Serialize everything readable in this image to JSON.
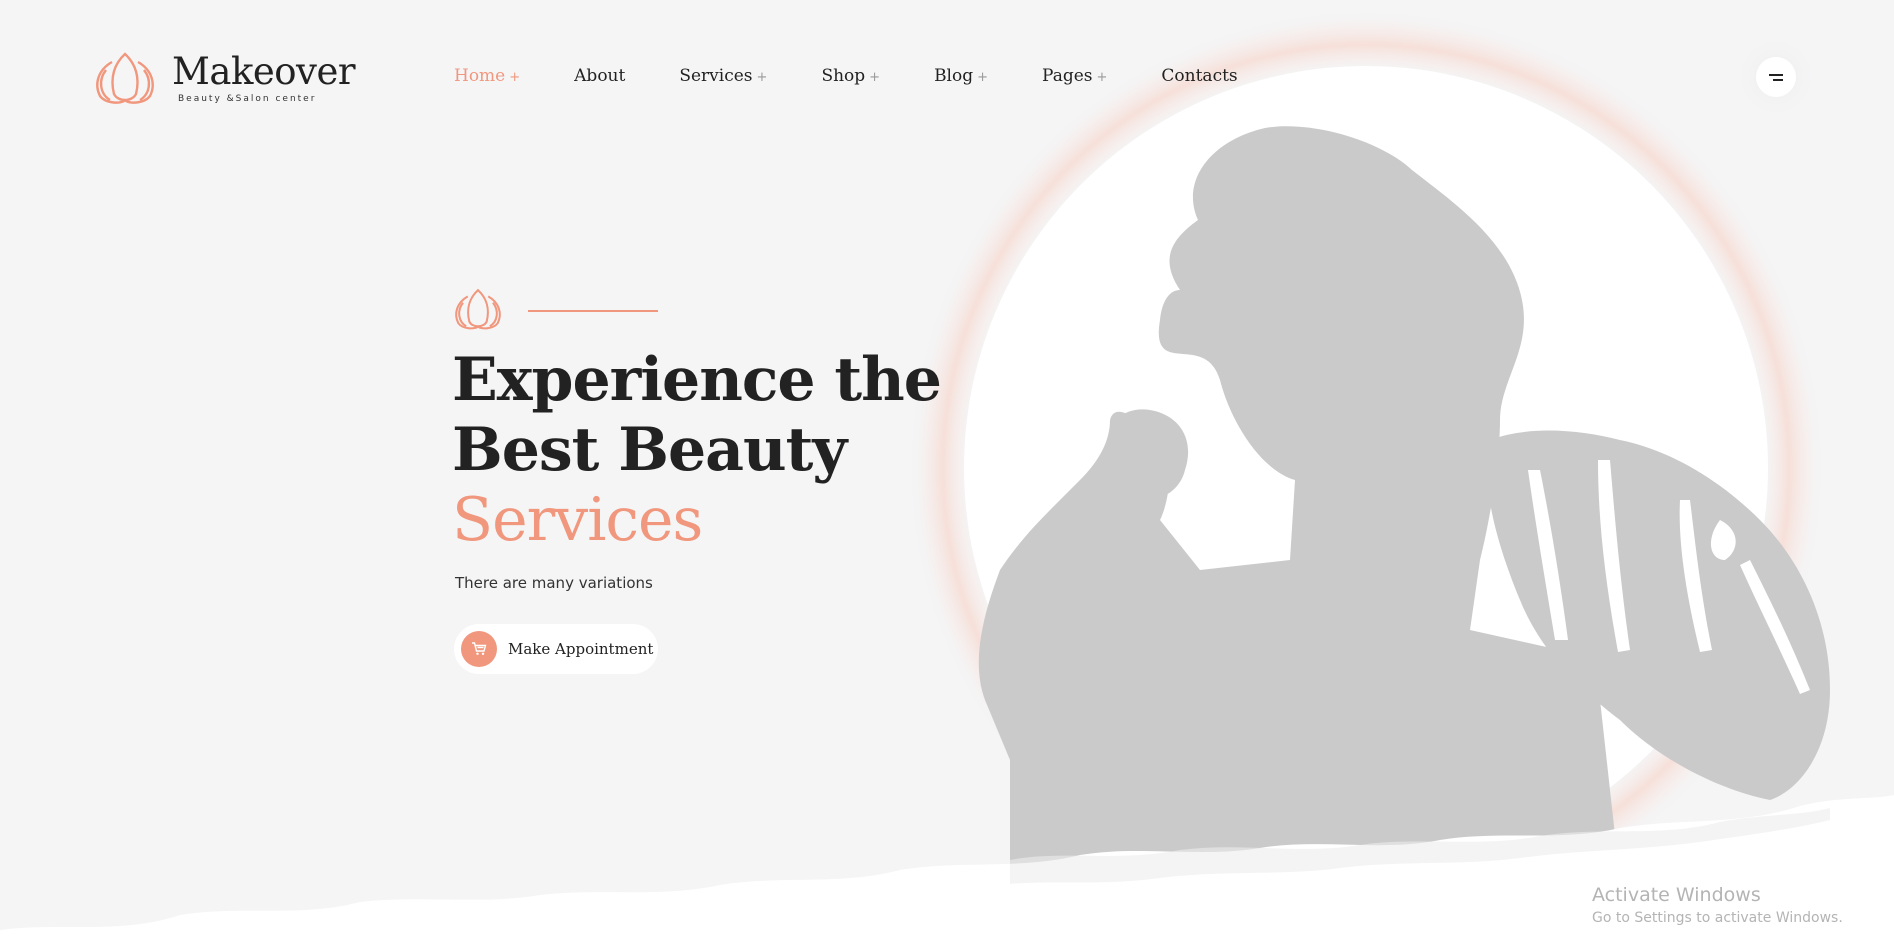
{
  "brand": {
    "name": "Makeover",
    "tagline": "Beauty &Salon center",
    "icon": "lotus-logo-icon",
    "accent_color": "#f0977d"
  },
  "nav": {
    "items": [
      {
        "label": "Home",
        "plus": "+",
        "active": true
      },
      {
        "label": "About",
        "plus": "",
        "active": false
      },
      {
        "label": "Services",
        "plus": "+",
        "active": false
      },
      {
        "label": "Shop",
        "plus": "+",
        "active": false
      },
      {
        "label": "Blog",
        "plus": "+",
        "active": false
      },
      {
        "label": "Pages",
        "plus": "+",
        "active": false
      },
      {
        "label": "Contacts",
        "plus": "",
        "active": false
      }
    ],
    "menu_icon": "hamburger-menu-icon"
  },
  "hero": {
    "title_line1": "Experience the",
    "title_line2": "Best Beauty",
    "title_accent": "Services",
    "subtitle": "There are many variations",
    "cta_label": "Make Appointment",
    "cta_icon": "cart-icon"
  },
  "os_overlay": {
    "title": "Activate Windows",
    "subtitle": "Go to Settings to activate Windows."
  }
}
